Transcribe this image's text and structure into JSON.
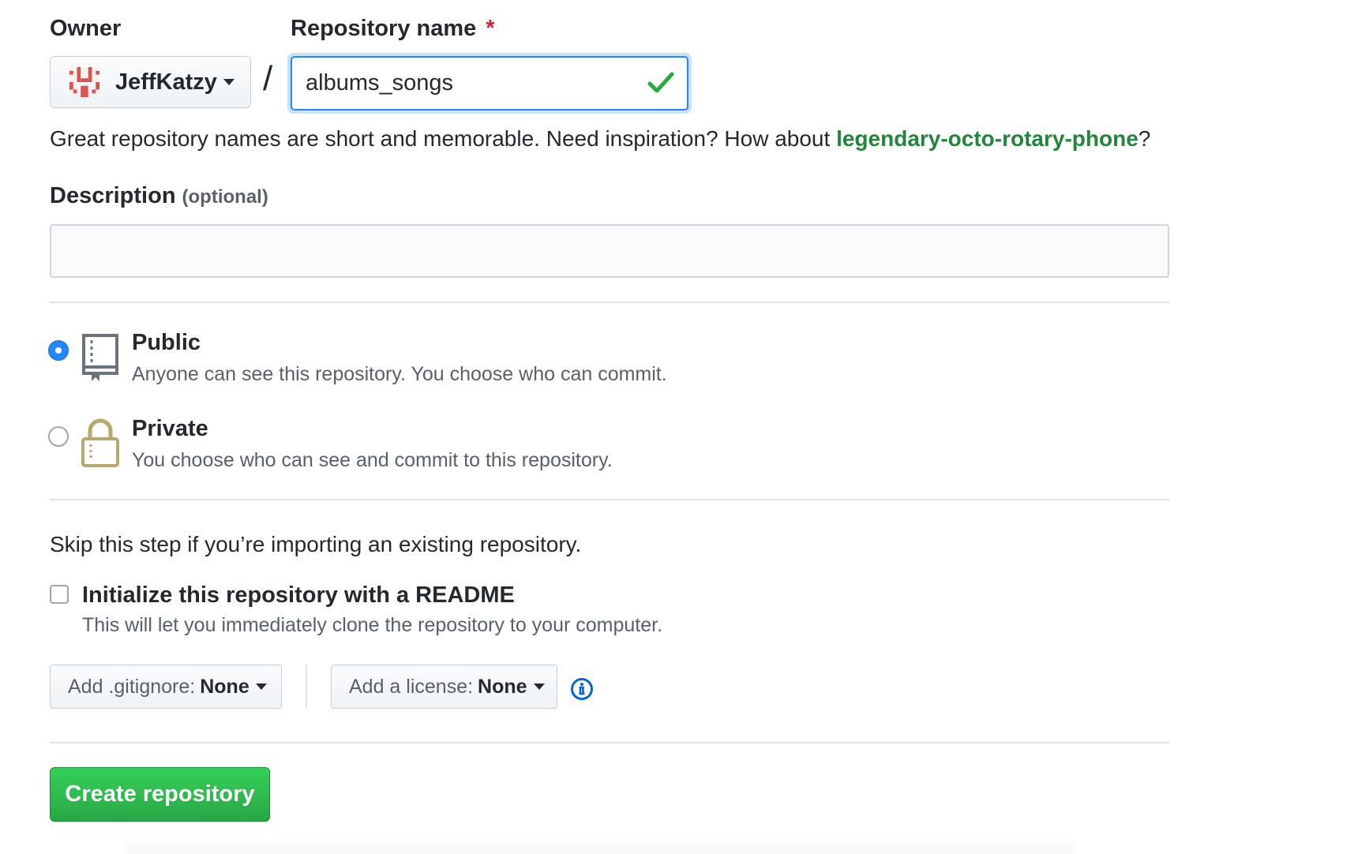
{
  "owner": {
    "label": "Owner",
    "name": "JeffKatzy"
  },
  "repository": {
    "label": "Repository name",
    "required_marker": "*",
    "value": "albums_songs",
    "separator": "/",
    "valid": true
  },
  "hint": {
    "prefix": "Great repository names are short and memorable. Need inspiration? How about ",
    "suggestion": "legendary-octo-rotary-phone",
    "suffix": "?"
  },
  "description": {
    "label": "Description",
    "optional": "(optional)",
    "value": ""
  },
  "visibility": {
    "selected": "public",
    "public": {
      "title": "Public",
      "desc": "Anyone can see this repository. You choose who can commit.",
      "icon": "repo-book-icon"
    },
    "private": {
      "title": "Private",
      "desc": "You choose who can see and commit to this repository.",
      "icon": "lock-icon"
    }
  },
  "init": {
    "skip_text": "Skip this step if you’re importing an existing repository.",
    "readme_title": "Initialize this repository with a README",
    "readme_desc": "This will let you immediately clone the repository to your computer.",
    "readme_checked": false
  },
  "gitignore": {
    "label": "Add .gitignore:",
    "value": "None"
  },
  "license": {
    "label": "Add a license:",
    "value": "None"
  },
  "create_button": "Create repository",
  "colors": {
    "accent_blue": "#2188ff",
    "success_green": "#28a745",
    "link_green": "#22863a",
    "required_red": "#cb2431",
    "lock_gold": "#b9a76b"
  }
}
